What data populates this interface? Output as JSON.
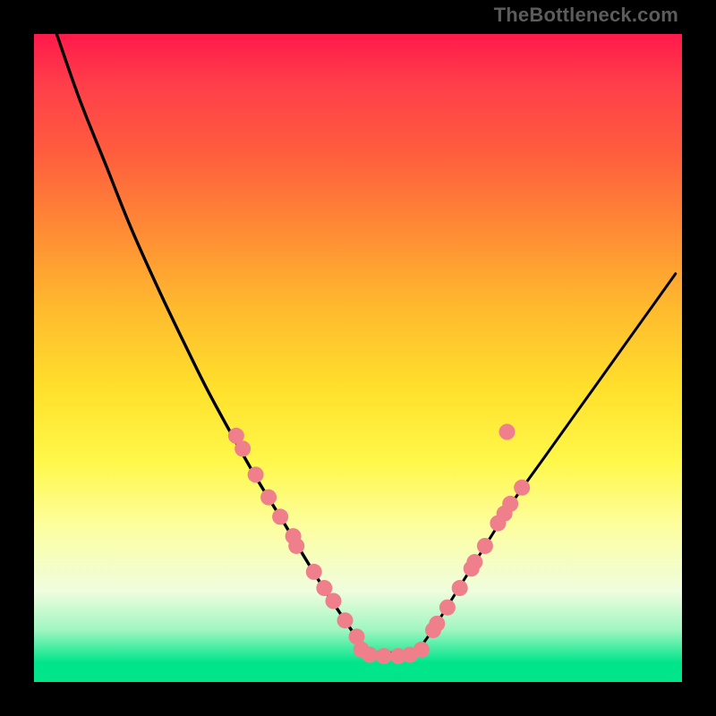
{
  "attribution": "TheBottleneck.com",
  "chart_data": {
    "type": "line",
    "title": "",
    "xlabel": "",
    "ylabel": "",
    "left_curve_points_xy01": [
      [
        0.035,
        0.0
      ],
      [
        0.07,
        0.1
      ],
      [
        0.11,
        0.2
      ],
      [
        0.15,
        0.3
      ],
      [
        0.195,
        0.4
      ],
      [
        0.243,
        0.5
      ],
      [
        0.268,
        0.55
      ],
      [
        0.295,
        0.6
      ],
      [
        0.323,
        0.65
      ],
      [
        0.352,
        0.7
      ],
      [
        0.383,
        0.75
      ],
      [
        0.413,
        0.8
      ],
      [
        0.45,
        0.86
      ],
      [
        0.49,
        0.92
      ],
      [
        0.51,
        0.95
      ]
    ],
    "right_curve_points_xy01": [
      [
        0.59,
        0.955
      ],
      [
        0.615,
        0.92
      ],
      [
        0.64,
        0.88
      ],
      [
        0.665,
        0.84
      ],
      [
        0.69,
        0.8
      ],
      [
        0.715,
        0.76
      ],
      [
        0.74,
        0.72
      ],
      [
        0.79,
        0.65
      ],
      [
        0.84,
        0.58
      ],
      [
        0.89,
        0.51
      ],
      [
        0.94,
        0.44
      ],
      [
        0.99,
        0.37
      ]
    ],
    "bottom_plateau_xy01": [
      [
        0.5,
        0.955
      ],
      [
        0.595,
        0.955
      ]
    ],
    "dots_xy01": [
      [
        0.312,
        0.62
      ],
      [
        0.322,
        0.64
      ],
      [
        0.342,
        0.68
      ],
      [
        0.362,
        0.715
      ],
      [
        0.38,
        0.745
      ],
      [
        0.4,
        0.775
      ],
      [
        0.405,
        0.79
      ],
      [
        0.432,
        0.83
      ],
      [
        0.448,
        0.855
      ],
      [
        0.462,
        0.875
      ],
      [
        0.48,
        0.905
      ],
      [
        0.498,
        0.93
      ],
      [
        0.505,
        0.95
      ],
      [
        0.518,
        0.958
      ],
      [
        0.54,
        0.96
      ],
      [
        0.562,
        0.96
      ],
      [
        0.58,
        0.958
      ],
      [
        0.598,
        0.95
      ],
      [
        0.616,
        0.92
      ],
      [
        0.622,
        0.91
      ],
      [
        0.638,
        0.885
      ],
      [
        0.657,
        0.855
      ],
      [
        0.675,
        0.825
      ],
      [
        0.68,
        0.815
      ],
      [
        0.696,
        0.79
      ],
      [
        0.716,
        0.755
      ],
      [
        0.735,
        0.725
      ],
      [
        0.753,
        0.7
      ],
      [
        0.726,
        0.74
      ],
      [
        0.73,
        0.614
      ]
    ],
    "axes_visible": false,
    "background": "rainbow-vertical",
    "colors": {
      "curve": "#000000",
      "dot_fill": "#ef7f8a",
      "dot_stroke": "#e65b68"
    }
  }
}
